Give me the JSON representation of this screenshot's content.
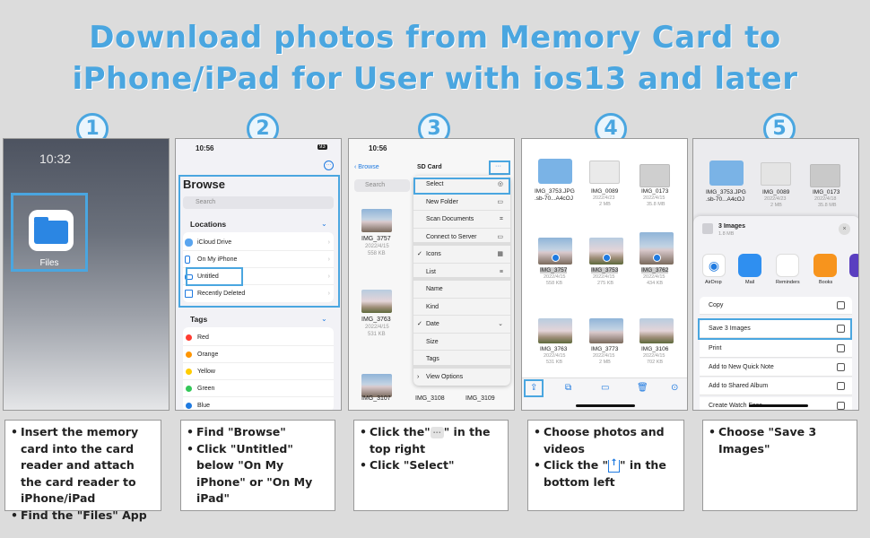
{
  "heading": {
    "line1": "Download photos from Memory Card to",
    "line2": "iPhone/iPad for User with ios13 and later"
  },
  "steps": [
    "1",
    "2",
    "3",
    "4",
    "5"
  ],
  "panel1": {
    "time": "10:32",
    "app_label": "Files"
  },
  "panel2": {
    "time": "10:56",
    "signal": "93",
    "title": "Browse",
    "search": "Search",
    "locations_header": "Locations",
    "locations": [
      "iCloud Drive",
      "On My iPhone",
      "Untitled",
      "Recently Deleted"
    ],
    "tags_header": "Tags",
    "tags": [
      {
        "name": "Red",
        "color": "#ff3b30"
      },
      {
        "name": "Orange",
        "color": "#ff9500"
      },
      {
        "name": "Yellow",
        "color": "#ffcc00"
      },
      {
        "name": "Green",
        "color": "#34c759"
      },
      {
        "name": "Blue",
        "color": "#1f7ae0"
      }
    ]
  },
  "panel3": {
    "time": "10:56",
    "back": "Browse",
    "folder": "SD Card",
    "search": "Search",
    "menu": [
      "Select",
      "New Folder",
      "Scan Documents",
      "Connect to Server",
      "Icons",
      "List",
      "Name",
      "Kind",
      "Date",
      "Size",
      "Tags",
      "View Options"
    ],
    "files": [
      {
        "name": "IMG_3757",
        "date": "2022/4/15",
        "size": "558 KB"
      },
      {
        "name": "IMG_3763",
        "date": "2022/4/15",
        "size": "531 KB"
      },
      {
        "name": "IMG_3107",
        "date": "",
        "size": ""
      },
      {
        "name": "IMG_3108",
        "date": "",
        "size": ""
      },
      {
        "name": "IMG_3109",
        "date": "",
        "size": ""
      }
    ]
  },
  "panel4": {
    "files": [
      {
        "name": "IMG_3753.JPG",
        "sub": ".sb-70...A4cOJ",
        "date": "",
        "size": ""
      },
      {
        "name": "IMG_0089",
        "sub": "",
        "date": "2022/4/23",
        "size": "2 MB"
      },
      {
        "name": "IMG_0173",
        "sub": "",
        "date": "2022/4/15",
        "size": "35.8 MB"
      },
      {
        "name": "IMG_3757",
        "sub": "",
        "date": "2022/4/15",
        "size": "558 KB"
      },
      {
        "name": "IMG_3753",
        "sub": "",
        "date": "2022/4/15",
        "size": "275 KB"
      },
      {
        "name": "IMG_3762",
        "sub": "",
        "date": "2022/4/15",
        "size": "434 KB"
      },
      {
        "name": "IMG_3763",
        "sub": "",
        "date": "2022/4/15",
        "size": "531 KB"
      },
      {
        "name": "IMG_3773",
        "sub": "",
        "date": "2022/4/15",
        "size": "2 MB"
      },
      {
        "name": "IMG_3106",
        "sub": "",
        "date": "2022/4/15",
        "size": "702 KB"
      }
    ]
  },
  "panel5": {
    "files": [
      {
        "name": "IMG_3753.JPG",
        "sub": ".sb-70...A4cOJ",
        "date": ""
      },
      {
        "name": "IMG_0089",
        "sub": "2022/4/23",
        "date": "2 MB"
      },
      {
        "name": "IMG_0173",
        "sub": "2022/4/18",
        "date": "35.8 MB"
      }
    ],
    "sheet_title": "3 Images",
    "sheet_size": "1.8 MB",
    "apps": [
      "AirDrop",
      "Mail",
      "Reminders",
      "Books"
    ],
    "actions": [
      "Copy",
      "Save 3 Images",
      "Print",
      "Add to New Quick Note",
      "Add to Shared Album",
      "Create Watch Face"
    ]
  },
  "instructions": {
    "step1": [
      "Insert the memory card into the card reader and attach the card reader to iPhone/iPad",
      "Find the \"Files\" App"
    ],
    "step2": [
      "Find \"Browse\"",
      "Click \"Untitled\" below \"On My iPhone\" or \"On My iPad\""
    ],
    "step3_a_pre": "Click the\"",
    "step3_a_post": "\" in the top right",
    "step3_b": "Click \"Select\"",
    "step4_a": "Choose photos and videos",
    "step4_b_pre": "Click the \"",
    "step4_b_post": "\" in the bottom left",
    "step5": [
      "Choose \"Save 3 Images\""
    ]
  },
  "colors": {
    "accent": "#4aa6e0",
    "ios_blue": "#1f7ae0"
  }
}
